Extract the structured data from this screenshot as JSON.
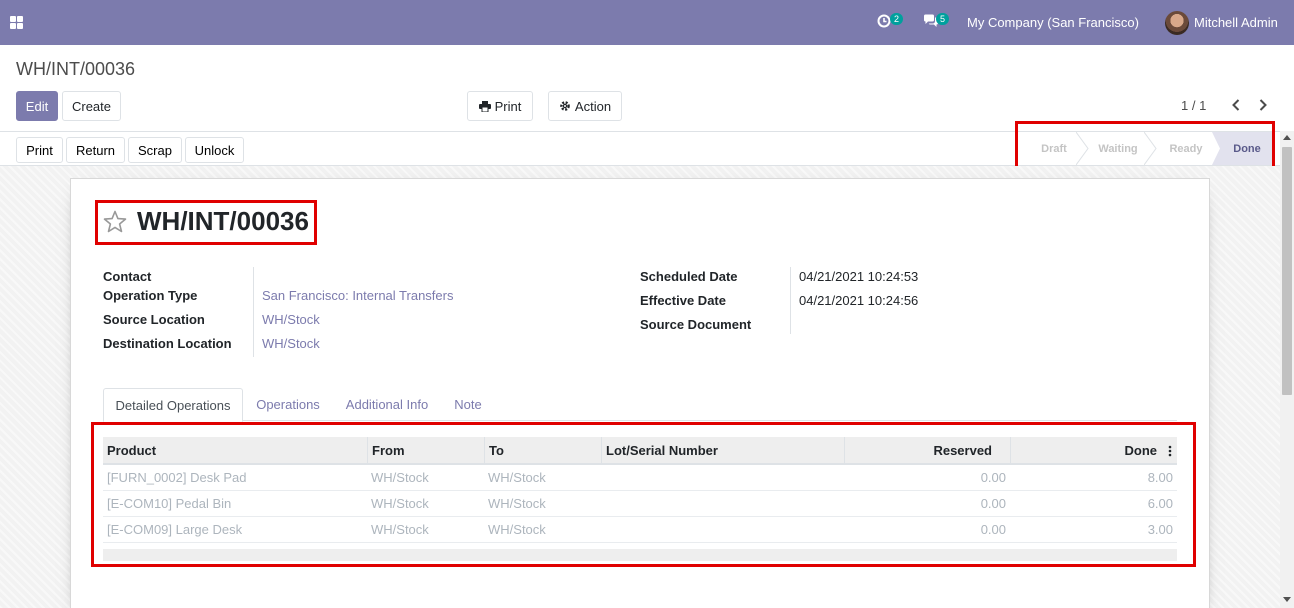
{
  "navbar": {
    "activities_count": "2",
    "messages_count": "5",
    "company": "My Company (San Francisco)",
    "user": "Mitchell Admin"
  },
  "breadcrumb": "WH/INT/00036",
  "control": {
    "edit": "Edit",
    "create": "Create",
    "print": "Print",
    "action": "Action",
    "pager": "1 / 1"
  },
  "header_buttons": [
    "Print",
    "Return",
    "Scrap",
    "Unlock"
  ],
  "statusbar": {
    "stages": [
      "Draft",
      "Waiting",
      "Ready",
      "Done"
    ],
    "current": "Done"
  },
  "record": {
    "name": "WH/INT/00036",
    "left_fields": [
      {
        "label": "Contact",
        "value": ""
      },
      {
        "label": "Operation Type",
        "value": "San Francisco: Internal Transfers"
      },
      {
        "label": "Source Location",
        "value": "WH/Stock"
      },
      {
        "label": "Destination Location",
        "value": "WH/Stock"
      }
    ],
    "right_fields": [
      {
        "label": "Scheduled Date",
        "value": "04/21/2021 10:24:53"
      },
      {
        "label": "Effective Date",
        "value": "04/21/2021 10:24:56"
      },
      {
        "label": "Source Document",
        "value": ""
      }
    ]
  },
  "tabs": [
    "Detailed Operations",
    "Operations",
    "Additional Info",
    "Note"
  ],
  "table": {
    "columns": [
      "Product",
      "From",
      "To",
      "Lot/Serial Number",
      "Reserved",
      "Done"
    ],
    "rows": [
      [
        "[FURN_0002] Desk Pad",
        "WH/Stock",
        "WH/Stock",
        "",
        "0.00",
        "8.00"
      ],
      [
        "[E-COM10] Pedal Bin",
        "WH/Stock",
        "WH/Stock",
        "",
        "0.00",
        "6.00"
      ],
      [
        "[E-COM09] Large Desk",
        "WH/Stock",
        "WH/Stock",
        "",
        "0.00",
        "3.00"
      ]
    ]
  },
  "colors": {
    "brand": "#7c7bad",
    "highlight": "#e00000",
    "badge": "#00a09d"
  }
}
